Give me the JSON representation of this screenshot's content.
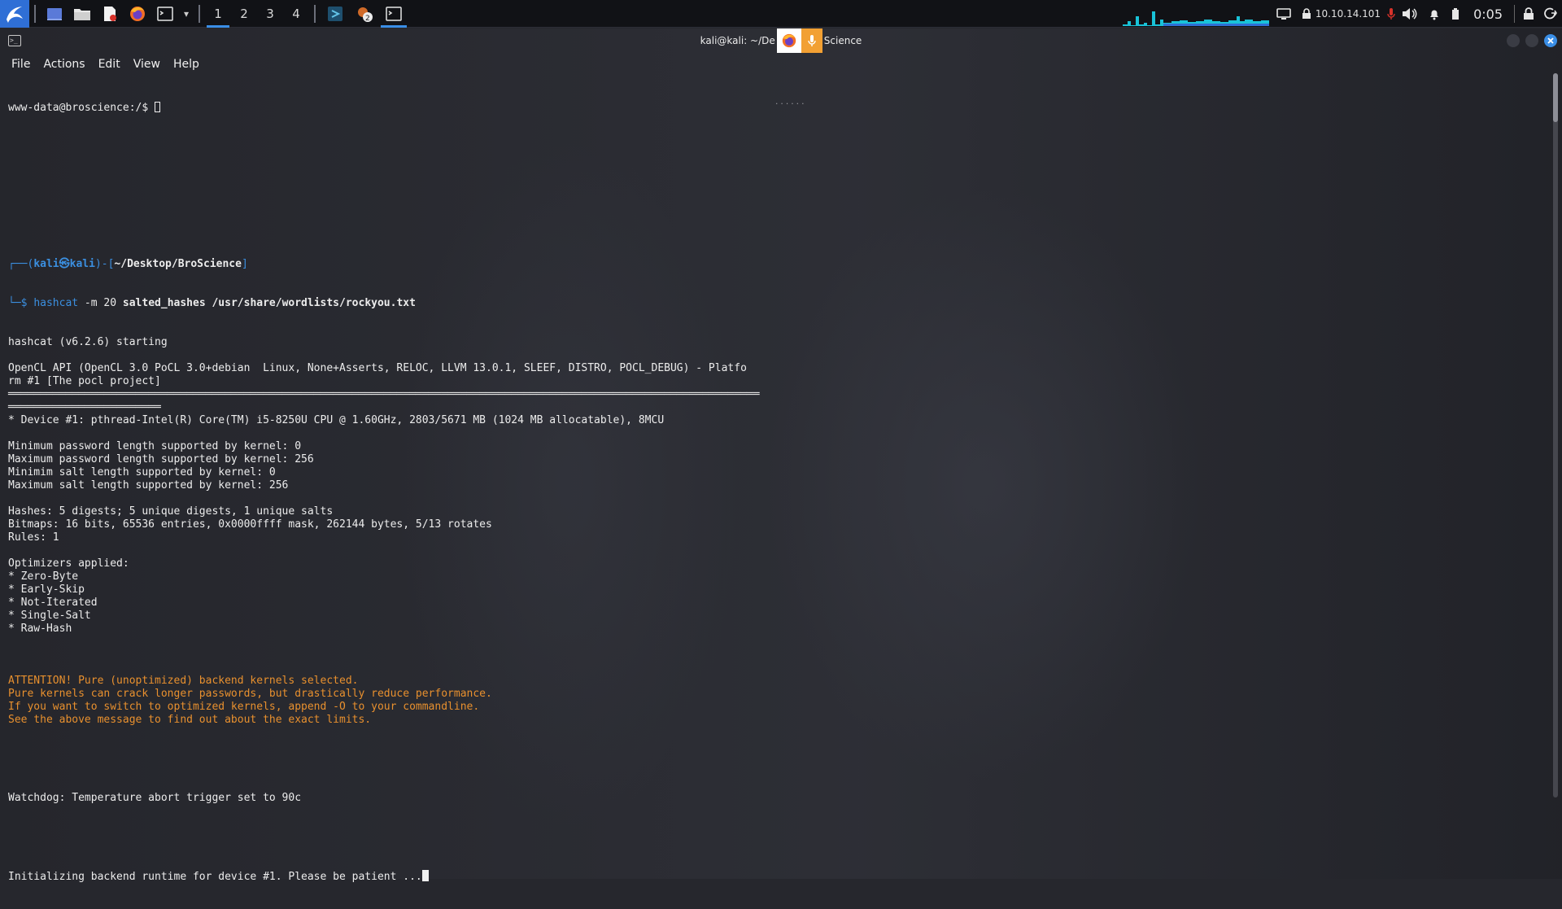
{
  "panel": {
    "workspaces": [
      "1",
      "2",
      "3",
      "4"
    ],
    "active_workspace": "1",
    "ip_address": "10.10.14.101",
    "clock": "0:05",
    "colors": {
      "accent": "#3a8ee6",
      "graph": "#19c3d8"
    }
  },
  "window": {
    "title_left": "kali@kali: ~/De",
    "title_right": "Science",
    "menu": [
      "File",
      "Actions",
      "Edit",
      "View",
      "Help"
    ],
    "pane_separator": "......"
  },
  "terminal": {
    "top_prompt": "www-data@broscience:/$ ",
    "zsh_prompt": {
      "open": "┌──(",
      "user_host": "kali㉿kali",
      "mid": ")-[",
      "path": "~/Desktop/BroScience",
      "close": "]",
      "prefix": "└─$ ",
      "command": "hashcat",
      "args_plain": " -m 20 ",
      "args_bold": "salted_hashes /usr/share/wordlists/rockyou.txt"
    },
    "output": [
      "hashcat (v6.2.6) starting",
      "",
      "OpenCL API (OpenCL 3.0 PoCL 3.0+debian  Linux, None+Asserts, RELOC, LLVM 13.0.1, SLEEF, DISTRO, POCL_DEBUG) - Platfo",
      "rm #1 [The pocl project]",
      "══════════════════════════════════════════════════════════════════════════════════════════════════════════════════════",
      "════════════════════════",
      "* Device #1: pthread-Intel(R) Core(TM) i5-8250U CPU @ 1.60GHz, 2803/5671 MB (1024 MB allocatable), 8MCU",
      "",
      "Minimum password length supported by kernel: 0",
      "Maximum password length supported by kernel: 256",
      "Minimim salt length supported by kernel: 0",
      "Maximum salt length supported by kernel: 256",
      "",
      "Hashes: 5 digests; 5 unique digests, 1 unique salts",
      "Bitmaps: 16 bits, 65536 entries, 0x0000ffff mask, 262144 bytes, 5/13 rotates",
      "Rules: 1",
      "",
      "Optimizers applied:",
      "* Zero-Byte",
      "* Early-Skip",
      "* Not-Iterated",
      "* Single-Salt",
      "* Raw-Hash",
      ""
    ],
    "attention": [
      "ATTENTION! Pure (unoptimized) backend kernels selected.",
      "Pure kernels can crack longer passwords, but drastically reduce performance.",
      "If you want to switch to optimized kernels, append -O to your commandline.",
      "See the above message to find out about the exact limits."
    ],
    "watchdog": "Watchdog: Temperature abort trigger set to 90c",
    "init_line": "Initializing backend runtime for device #1. Please be patient ..."
  }
}
